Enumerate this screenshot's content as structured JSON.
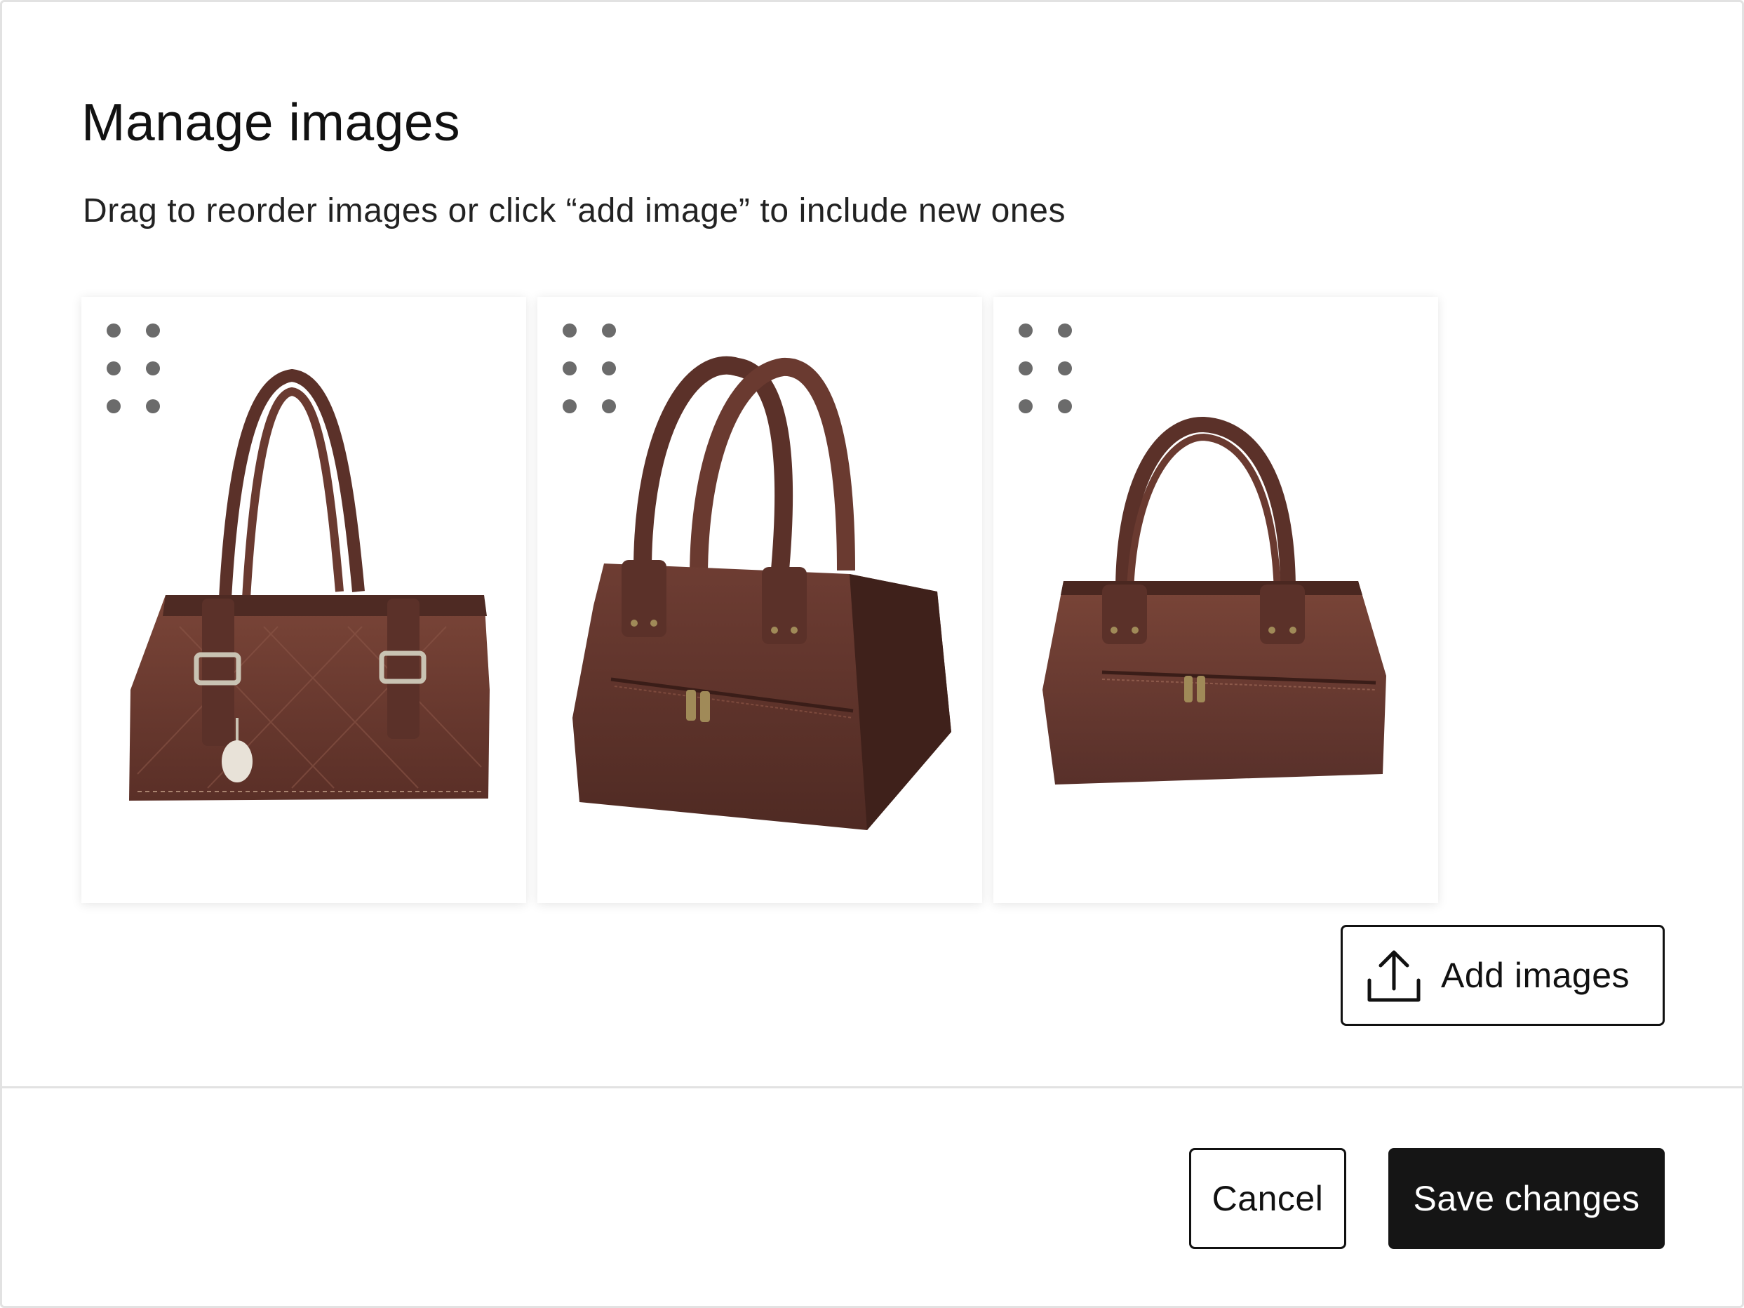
{
  "dialog": {
    "title": "Manage images",
    "subtitle": "Drag to reorder images or click “add image” to include new ones"
  },
  "images": [
    {
      "name": "brown-leather-shoulder-bag",
      "handle_icon": "drag-handle-icon"
    },
    {
      "name": "brown-leather-doctor-bag",
      "handle_icon": "drag-handle-icon"
    },
    {
      "name": "brown-leather-satchel-bag",
      "handle_icon": "drag-handle-icon"
    }
  ],
  "add_images": {
    "label": "Add images",
    "icon": "upload-icon"
  },
  "footer": {
    "cancel_label": "Cancel",
    "save_label": "Save changes"
  },
  "colors": {
    "primary_button_bg": "#151515",
    "primary_button_text": "#ffffff",
    "border": "#111111",
    "divider": "#e2e2e2",
    "handle_dots": "#6b6b6b",
    "leather": "#6a3a30"
  }
}
